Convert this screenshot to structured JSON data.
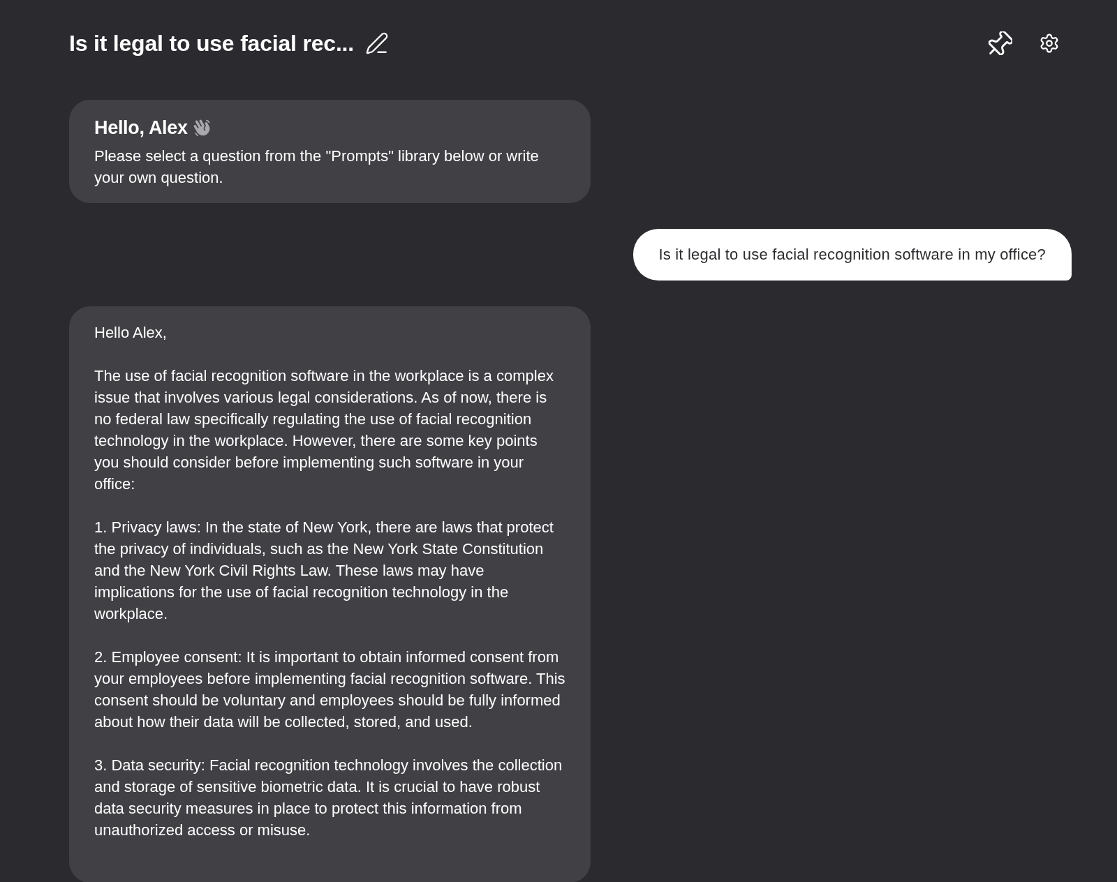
{
  "header": {
    "title": "Is it legal to use facial rec..."
  },
  "messages": [
    {
      "kind": "greeting",
      "title": "Hello, Alex",
      "text": "Please select a question from the \"Prompts\" library below or write your own question."
    },
    {
      "kind": "user",
      "text": "Is it legal to use facial recognition software in my office?"
    },
    {
      "kind": "reply",
      "paragraphs": [
        "Hello Alex,",
        "The use of facial recognition software in the workplace is a complex issue that involves various legal considerations. As of now, there is no federal law specifically regulating the use of facial recognition technology in the workplace. However, there are some key points you should consider before implementing such software in your office:",
        "1. Privacy laws: In the state of New York, there are laws that protect the privacy of individuals, such as the New York State Constitution and the New York Civil Rights Law. These laws may have implications for the use of facial recognition technology in the workplace.",
        "2. Employee consent: It is important to obtain informed consent from your employees before implementing facial recognition software. This consent should be voluntary and employees should be fully informed about how their data will be collected, stored, and used.",
        "3. Data security: Facial recognition technology involves the collection and storage of sensitive biometric data. It is crucial to have robust data security measures in place to protect this information from unauthorized access or misuse."
      ]
    }
  ]
}
